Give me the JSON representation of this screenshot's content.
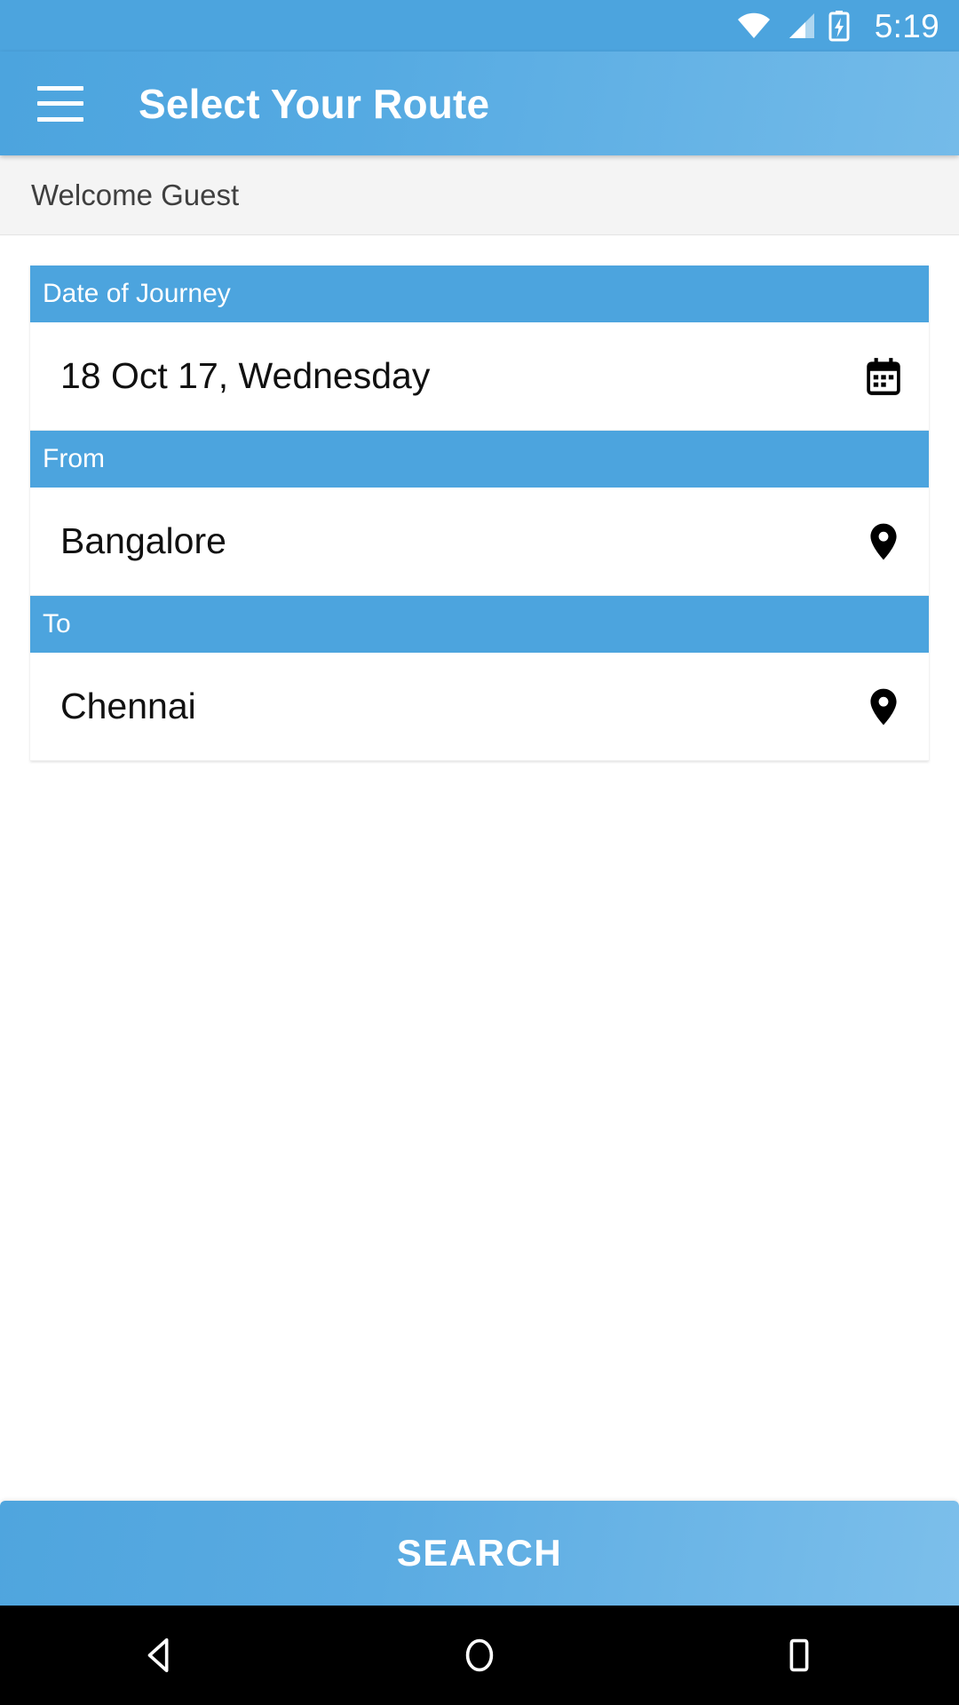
{
  "status_bar": {
    "time": "5:19",
    "icons": [
      "wifi-icon",
      "cellular-signal-icon",
      "battery-charging-icon"
    ]
  },
  "app_bar": {
    "menu_icon": "hamburger-menu-icon",
    "title": "Select Your Route"
  },
  "welcome": {
    "text": "Welcome Guest"
  },
  "form": {
    "fields": [
      {
        "label": "Date of Journey",
        "value": "18 Oct 17, Wednesday",
        "icon": "calendar-icon"
      },
      {
        "label": "From",
        "value": "Bangalore",
        "icon": "location-pin-icon"
      },
      {
        "label": "To",
        "value": "Chennai",
        "icon": "location-pin-icon"
      }
    ]
  },
  "search_button": {
    "label": "SEARCH"
  },
  "nav_bar": {
    "buttons": [
      "back-icon",
      "home-icon",
      "recents-icon"
    ]
  },
  "colors": {
    "accent_blue": "#4ca4de",
    "appbar_gradient_end": "#74bbe9",
    "welcome_bg": "#f4f4f4",
    "nav_bg": "#000000",
    "value_text": "#111111"
  }
}
